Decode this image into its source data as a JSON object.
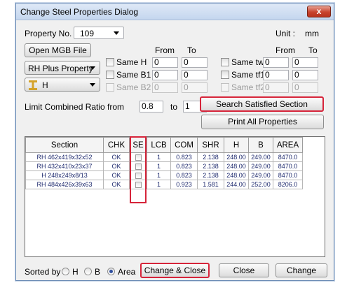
{
  "window": {
    "title": "Change Steel Properties Dialog",
    "close_label": "x"
  },
  "property": {
    "label": "Property No.",
    "value": "109",
    "unit_label": "Unit :",
    "unit_value": "mm"
  },
  "open_mgb_label": "Open MGB File",
  "property_type": {
    "value": "RH Plus Property"
  },
  "shape": {
    "value": "H"
  },
  "columns_left": {
    "from": "From",
    "to": "To"
  },
  "columns_right": {
    "from": "From",
    "to": "To"
  },
  "same_h": {
    "label": "Same H",
    "from": "0",
    "to": "0"
  },
  "same_b1": {
    "label": "Same B1",
    "from": "0",
    "to": "0"
  },
  "same_b2": {
    "label": "Same B2",
    "from": "0",
    "to": "0"
  },
  "same_tw": {
    "label": "Same tw",
    "from": "0",
    "to": "0"
  },
  "same_tf1": {
    "label": "Same tf1",
    "from": "0",
    "to": "0"
  },
  "same_tf2": {
    "label": "Same tf2",
    "from": "0",
    "to": "0"
  },
  "limit": {
    "label": "Limit Combined Ratio from",
    "from": "0.8",
    "to_label": "to",
    "to": "1"
  },
  "search_button_label": "Search Satisfied Section",
  "print_button_label": "Print All Properties",
  "table": {
    "headers": [
      "Section",
      "CHK",
      "SE",
      "LCB",
      "COM",
      "SHR",
      "H",
      "B",
      "AREA"
    ],
    "rows": [
      {
        "section": "RH 462x419x32x52",
        "chk": "OK",
        "lcb": "1",
        "com": "0.823",
        "shr": "2.138",
        "h": "248.00",
        "b": "249.00",
        "area": "8470.0"
      },
      {
        "section": "RH 432x410x23x37",
        "chk": "OK",
        "lcb": "1",
        "com": "0.823",
        "shr": "2.138",
        "h": "248.00",
        "b": "249.00",
        "area": "8470.0"
      },
      {
        "section": "H 248x249x8/13",
        "chk": "OK",
        "lcb": "1",
        "com": "0.823",
        "shr": "2.138",
        "h": "248.00",
        "b": "249.00",
        "area": "8470.0"
      },
      {
        "section": "RH 484x426x39x63",
        "chk": "OK",
        "lcb": "1",
        "com": "0.923",
        "shr": "1.581",
        "h": "244.00",
        "b": "252.00",
        "area": "8206.0"
      }
    ]
  },
  "sort": {
    "label": "Sorted by",
    "options": [
      "H",
      "B",
      "Area"
    ],
    "selected": "Area"
  },
  "footer": {
    "change_close_label": "Change & Close",
    "close_label": "Close",
    "change_label": "Change"
  },
  "colors": {
    "highlight": "#d6243a",
    "cell_text": "#1e2a6e"
  }
}
